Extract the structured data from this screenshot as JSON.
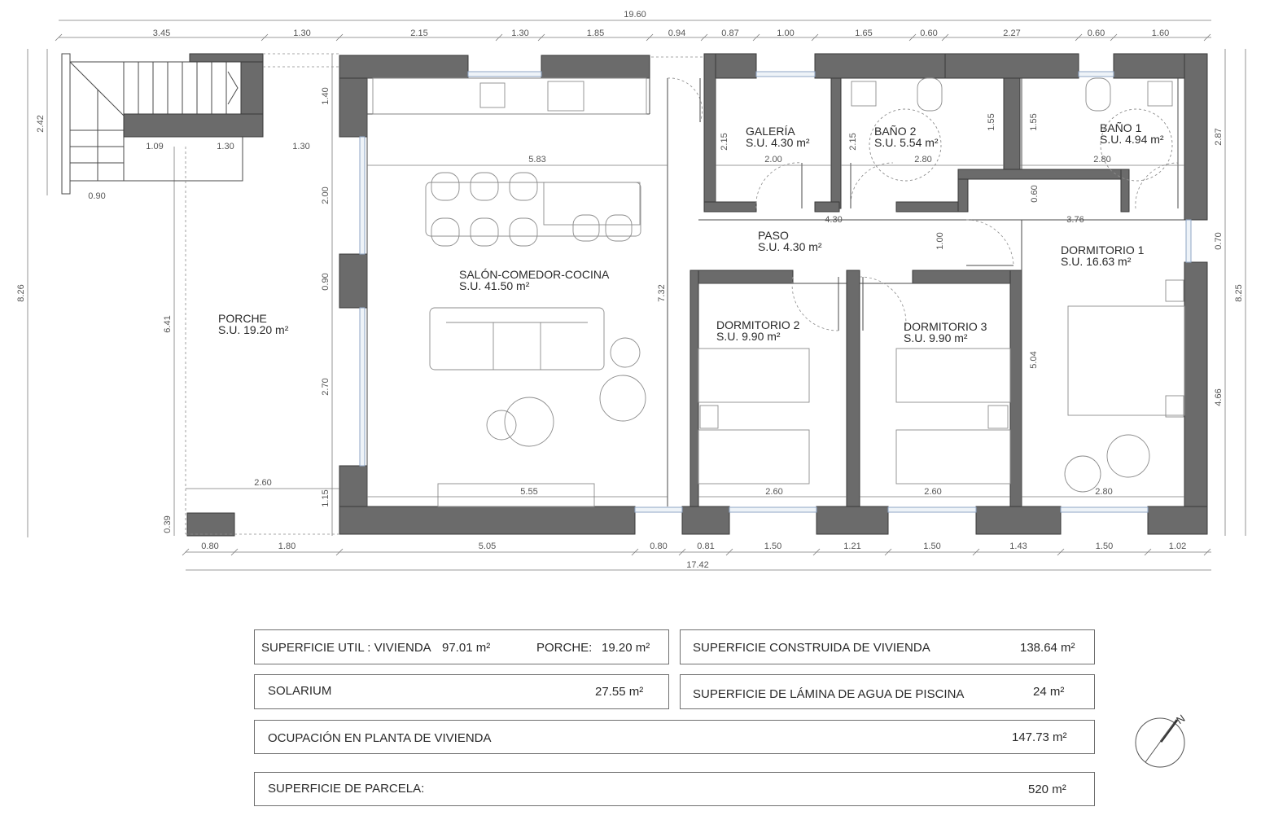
{
  "dimensions": {
    "overall_top": "19.60",
    "overall_bottom": "17.42",
    "top": [
      "3.45",
      "1.30",
      "2.15",
      "1.30",
      "1.85",
      "0.94",
      "0.87",
      "1.00",
      "1.65",
      "0.60",
      "2.27",
      "0.60",
      "1.60"
    ],
    "bottom": [
      "0.80",
      "1.80",
      "5.05",
      "0.80",
      "0.81",
      "1.50",
      "1.21",
      "1.50",
      "1.43",
      "1.50",
      "1.02"
    ],
    "left_outer": [
      "2.42",
      "8.26"
    ],
    "left_inner": [
      "6.41",
      "0.39"
    ],
    "mid_vertical": [
      "1.40",
      "2.00",
      "0.90",
      "2.70",
      "1.15"
    ],
    "right_outer": [
      "2.87",
      "0.70",
      "4.66",
      "8.25"
    ],
    "stairs": [
      "1.09",
      "1.30",
      "1.30",
      "0.90"
    ],
    "interior": {
      "galeria_h": "2.15",
      "galeria_w": "2.00",
      "bano2_h": "2.15",
      "bano2_w": "2.80",
      "bano2_h2": "1.55",
      "bano1_h": "1.55",
      "bano1_w": "2.80",
      "bano1_dim": "0.60",
      "living_w": "5.83",
      "living_h": "7.32",
      "living_bottom": "5.55",
      "porch_w": "2.60",
      "paso_w1": "4.30",
      "paso_w2": "3.76",
      "paso_h": "1.00",
      "d2_w": "2.60",
      "d3_w": "2.60",
      "d1_w": "2.80",
      "d1_h": "5.04"
    }
  },
  "rooms": {
    "galeria": {
      "name": "GALERÍA",
      "area": "S.U. 4.30 m²"
    },
    "bano2": {
      "name": "BAÑO 2",
      "area": "S.U. 5.54 m²"
    },
    "bano1": {
      "name": "BAÑO 1",
      "area": "S.U. 4.94 m²"
    },
    "paso": {
      "name": "PASO",
      "area": "S.U. 4.30 m²"
    },
    "salon": {
      "name": "SALÓN-COMEDOR-COCINA",
      "area": "S.U. 41.50 m²"
    },
    "porche": {
      "name": "PORCHE",
      "area": "S.U. 19.20 m²"
    },
    "dormitorio1": {
      "name": "DORMITORIO 1",
      "area": "S.U. 16.63 m²"
    },
    "dormitorio2": {
      "name": "DORMITORIO 2",
      "area": "S.U. 9.90 m²"
    },
    "dormitorio3": {
      "name": "DORMITORIO 3",
      "area": "S.U. 9.90 m²"
    }
  },
  "summary": {
    "util_label": "SUPERFICIE UTIL :  VIVIENDA",
    "util_value": "97.01  m²",
    "porche_label": "PORCHE:",
    "porche_value": "19.20  m²",
    "construida_label": "SUPERFICIE CONSTRUIDA DE VIVIENDA",
    "construida_value": "138.64  m²",
    "solarium_label": "SOLARIUM",
    "solarium_value": "27.55 m²",
    "lamina_label": "SUPERFICIE DE LÁMINA DE AGUA DE PISCINA",
    "lamina_value": "24  m²",
    "ocupacion_label": "OCUPACIÓN EN PLANTA DE VIVIENDA",
    "ocupacion_value": "147.73 m²",
    "parcela_label": "SUPERFICIE DE PARCELA:",
    "parcela_value": "520 m²"
  },
  "north_label": "N"
}
